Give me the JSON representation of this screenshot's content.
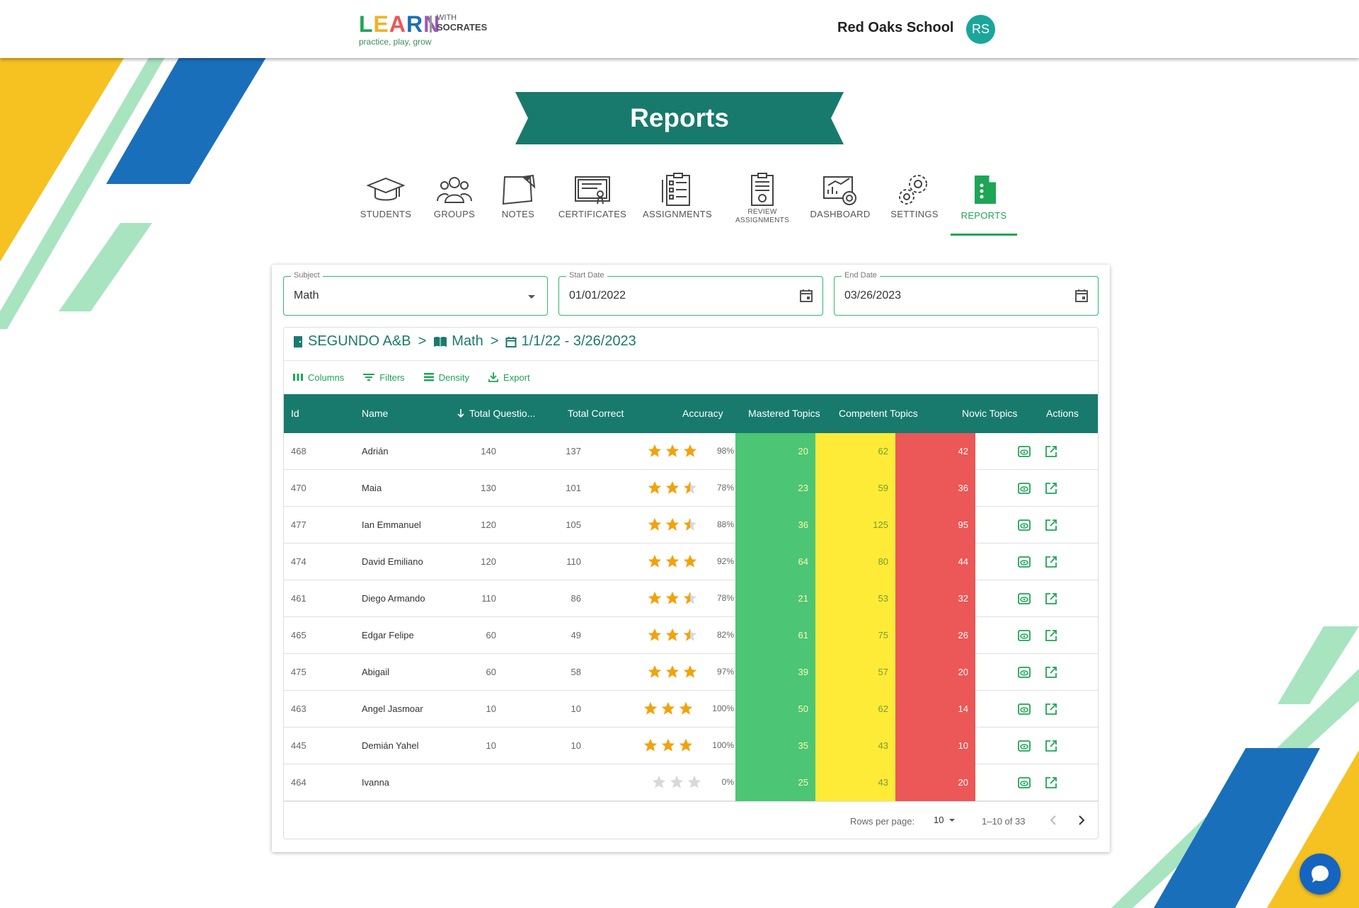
{
  "header": {
    "logo": {
      "word": "LEARN",
      "with": "WITH",
      "brand": "SOCRATES",
      "tagline": "practice, play, grow"
    },
    "school_name": "Red Oaks School",
    "avatar_initials": "RS"
  },
  "page_title": "Reports",
  "nav": [
    {
      "label": "STUDENTS"
    },
    {
      "label": "GROUPS"
    },
    {
      "label": "NOTES"
    },
    {
      "label": "CERTIFICATES"
    },
    {
      "label": "ASSIGNMENTS"
    },
    {
      "label": "REVIEW ASSIGNMENTS"
    },
    {
      "label": "DASHBOARD"
    },
    {
      "label": "SETTINGS"
    },
    {
      "label": "REPORTS",
      "active": true
    }
  ],
  "filters": {
    "subject": {
      "label": "Subject",
      "value": "Math"
    },
    "start_date": {
      "label": "Start Date",
      "value": "01/01/2022"
    },
    "end_date": {
      "label": "End Date",
      "value": "03/26/2023"
    }
  },
  "breadcrumb": {
    "group": "SEGUNDO A&B",
    "subject": "Math",
    "range": "1/1/22 - 3/26/2023"
  },
  "toolbar": {
    "columns": "Columns",
    "filters": "Filters",
    "density": "Density",
    "export": "Export"
  },
  "table": {
    "headers": {
      "id": "Id",
      "name": "Name",
      "total_questions": "Total Questio...",
      "total_correct": "Total Correct",
      "accuracy": "Accuracy",
      "mastered": "Mastered Topics",
      "competent": "Competent Topics",
      "novice": "Novic Topics",
      "actions": "Actions"
    },
    "rows": [
      {
        "id": "468",
        "name": "Adrián",
        "total_questions": "140",
        "total_correct": "137",
        "stars": 3,
        "accuracy": "98%",
        "mastered": "20",
        "competent": "62",
        "novice": "42"
      },
      {
        "id": "470",
        "name": "Maia",
        "total_questions": "130",
        "total_correct": "101",
        "stars": 2.5,
        "accuracy": "78%",
        "mastered": "23",
        "competent": "59",
        "novice": "36"
      },
      {
        "id": "477",
        "name": "Ian Emmanuel",
        "total_questions": "120",
        "total_correct": "105",
        "stars": 2.5,
        "accuracy": "88%",
        "mastered": "36",
        "competent": "125",
        "novice": "95"
      },
      {
        "id": "474",
        "name": "David Emiliano",
        "total_questions": "120",
        "total_correct": "110",
        "stars": 3,
        "accuracy": "92%",
        "mastered": "64",
        "competent": "80",
        "novice": "44"
      },
      {
        "id": "461",
        "name": "Diego Armando",
        "total_questions": "110",
        "total_correct": "86",
        "stars": 2.5,
        "accuracy": "78%",
        "mastered": "21",
        "competent": "53",
        "novice": "32"
      },
      {
        "id": "465",
        "name": "Edgar Felipe",
        "total_questions": "60",
        "total_correct": "49",
        "stars": 2.5,
        "accuracy": "82%",
        "mastered": "61",
        "competent": "75",
        "novice": "26"
      },
      {
        "id": "475",
        "name": "Abigail",
        "total_questions": "60",
        "total_correct": "58",
        "stars": 3,
        "accuracy": "97%",
        "mastered": "39",
        "competent": "57",
        "novice": "20"
      },
      {
        "id": "463",
        "name": "Angel Jasmoar",
        "total_questions": "10",
        "total_correct": "10",
        "stars": 3,
        "accuracy": "100%",
        "mastered": "50",
        "competent": "62",
        "novice": "14"
      },
      {
        "id": "445",
        "name": "Demián Yahel",
        "total_questions": "10",
        "total_correct": "10",
        "stars": 3,
        "accuracy": "100%",
        "mastered": "35",
        "competent": "43",
        "novice": "10"
      },
      {
        "id": "464",
        "name": "Ivanna",
        "total_questions": "",
        "total_correct": "",
        "stars": 0,
        "accuracy": "0%",
        "mastered": "25",
        "competent": "43",
        "novice": "20"
      }
    ]
  },
  "pagination": {
    "rows_per_page_label": "Rows per page:",
    "rows_per_page": "10",
    "range": "1–10 of 33"
  },
  "colors": {
    "brand_teal": "#187a6c",
    "accent_green": "#1ea556",
    "mastered": "#4cc575",
    "competent": "#fdeb37",
    "novice": "#ec5757",
    "star": "#f2a20c",
    "star_empty": "#d8d8d8"
  }
}
